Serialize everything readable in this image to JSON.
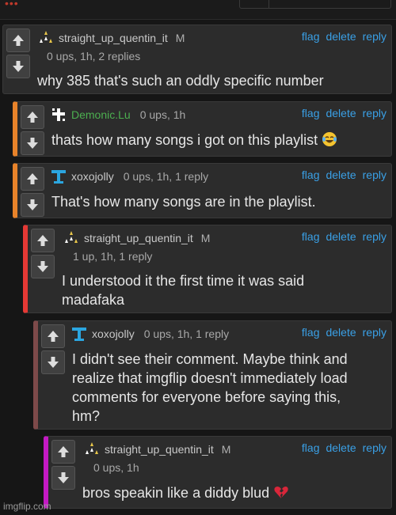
{
  "comments": [
    {
      "user": "straight_up_quentin_it",
      "badge": "M",
      "meta": "0 ups, 1h, 2 replies",
      "text": "why 385 that's such an oddly specific number",
      "avatar": "triangle-stars-icon",
      "bar_color": ""
    },
    {
      "user": "Demonic.Lu",
      "badge": "",
      "meta": "0 ups, 1h",
      "text": "thats how many songs i got on this playlist",
      "emoji": "laughing-crying-emoji",
      "avatar": "pixel-cross-icon",
      "user_color": "#4caf50",
      "bar_color": "#e8832a"
    },
    {
      "user": "xoxojolly",
      "badge": "",
      "meta": "0 ups, 1h, 1 reply",
      "text": "That's how many songs are in the playlist.",
      "avatar": "pixel-t-icon",
      "bar_color": "#e8832a"
    },
    {
      "user": "straight_up_quentin_it",
      "badge": "M",
      "meta": "1 up, 1h, 1 reply",
      "text_lines": [
        "I understood it the first time it was said",
        "madafaka"
      ],
      "avatar": "triangle-stars-icon",
      "bar_color": "#e53935"
    },
    {
      "user": "xoxojolly",
      "badge": "",
      "meta": "0 ups, 1h, 1 reply",
      "text_lines": [
        "I didn't see their comment. Maybe think and",
        "realize that imgflip doesn't immediately load",
        "comments for everyone before saying this,",
        "hm?"
      ],
      "avatar": "pixel-t-icon",
      "bar_color": "#7d4a4a"
    },
    {
      "user": "straight_up_quentin_it",
      "badge": "M",
      "meta": "0 ups, 1h",
      "text": "bros speakin like a diddy blud",
      "emoji": "broken-heart-emoji",
      "avatar": "triangle-stars-icon",
      "bar_color": "#c51ac5"
    }
  ],
  "actions": {
    "flag": "flag",
    "delete": "delete",
    "reply": "reply"
  },
  "watermark": "imgflip.com"
}
